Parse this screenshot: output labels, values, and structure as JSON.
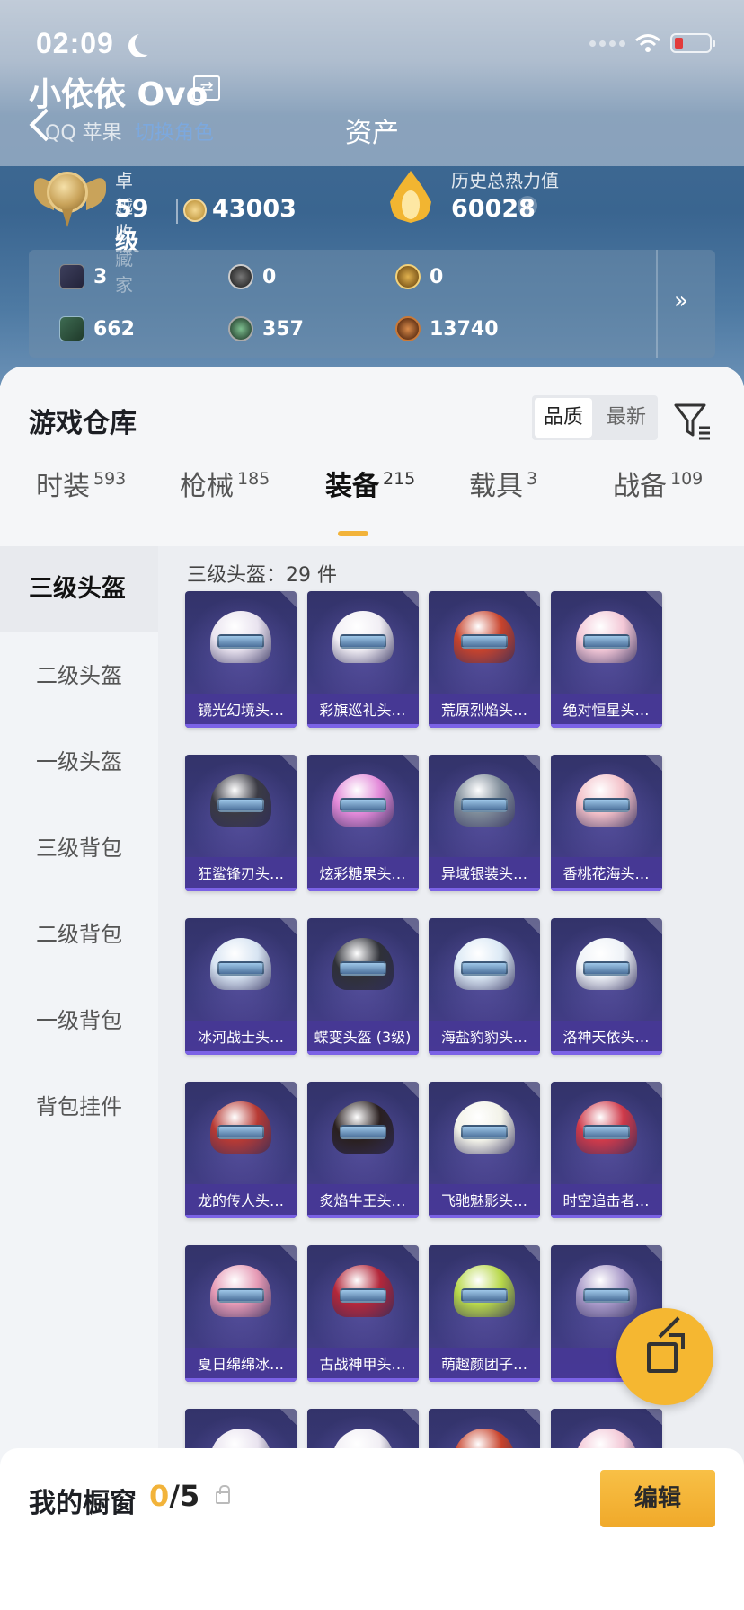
{
  "status_bar": {
    "time": "02:09"
  },
  "header": {
    "username": "小依依 Ovo",
    "account_sub": "QQ 苹果",
    "account_link": "切换角色",
    "title": "资产"
  },
  "stats": {
    "collector_label": "卓越收藏家",
    "level": "59级",
    "coins": "43003",
    "heat_label": "历史总热力值",
    "heat_value": "60028",
    "help": "?"
  },
  "resources": {
    "row1": [
      {
        "value": "3"
      },
      {
        "value": "0"
      },
      {
        "value": "0"
      }
    ],
    "row2": [
      {
        "value": "662"
      },
      {
        "value": "357"
      },
      {
        "value": "13740"
      }
    ],
    "more": "»"
  },
  "warehouse": {
    "title": "游戏仓库",
    "sort": {
      "quality": "品质",
      "latest": "最新"
    }
  },
  "tabs": [
    {
      "label": "时装",
      "count": "593"
    },
    {
      "label": "枪械",
      "count": "185"
    },
    {
      "label": "装备",
      "count": "215"
    },
    {
      "label": "载具",
      "count": "3"
    },
    {
      "label": "战备",
      "count": "109"
    }
  ],
  "sidebar": [
    {
      "label": "三级头盔"
    },
    {
      "label": "二级头盔"
    },
    {
      "label": "一级头盔"
    },
    {
      "label": "三级背包"
    },
    {
      "label": "二级背包"
    },
    {
      "label": "一级背包"
    },
    {
      "label": "背包挂件"
    }
  ],
  "content": {
    "heading": "三级头盔：29 件",
    "items": [
      "镜光幻境头…",
      "彩旗巡礼头…",
      "荒原烈焰头…",
      "绝对恒星头…",
      "狂鲨锋刃头…",
      "炫彩糖果头…",
      "异域银装头…",
      "香桃花海头…",
      "冰河战士头…",
      "蝶变头盔 (3级)",
      "海盐豹豹头…",
      "洛神天依头…",
      "龙的传人头…",
      "炙焰牛王头…",
      "飞驰魅影头…",
      "时空追击者…",
      "夏日绵绵冰…",
      "古战神甲头…",
      "萌趣颜团子…",
      ""
    ]
  },
  "bottom_bar": {
    "showcase_label": "我的橱窗",
    "showcase_current": "0",
    "showcase_total": "/5",
    "edit_label": "编辑"
  },
  "colors": {
    "accent": "#f2b33a",
    "card_bg": "#3a3a7c",
    "card_label_bg": "#4a3a96"
  }
}
